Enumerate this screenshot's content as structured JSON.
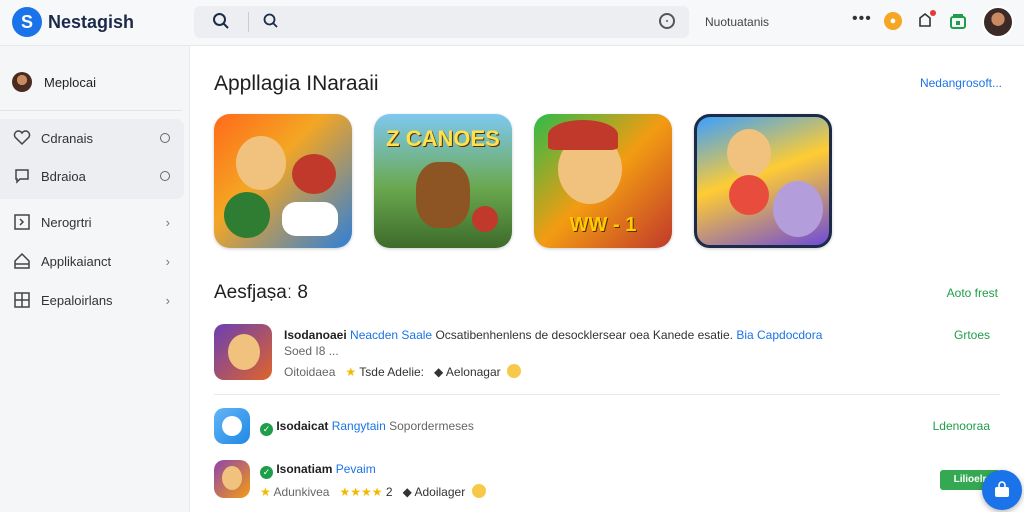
{
  "header": {
    "brand": "Nestagish",
    "search_placeholder": "",
    "link": "Nuotuatanis",
    "coin_icon": "coin-icon",
    "more_icon": "more-dots-icon"
  },
  "sidebar": {
    "profile_name": "Meplocai",
    "items": [
      {
        "label": "Cdranais",
        "icon": "heart-icon",
        "trail": "circle"
      },
      {
        "label": "Bdraioa",
        "icon": "chat-icon",
        "trail": "circle"
      },
      {
        "label": "Nerogrtri",
        "icon": "box-icon",
        "trail": "chevron"
      },
      {
        "label": "Applikaianct",
        "icon": "home-icon",
        "trail": "chevron"
      },
      {
        "label": "Eepaloirlans",
        "icon": "grid-icon",
        "trail": "chevron"
      }
    ]
  },
  "main": {
    "section1_title": "Appllagia INaraaii",
    "section1_link": "Nedangrosoft...",
    "tiles": [
      {
        "name": "game-tile-1",
        "text": ""
      },
      {
        "name": "game-tile-2",
        "text": "Z CANOES"
      },
      {
        "name": "game-tile-3",
        "text": "WW - 1"
      },
      {
        "name": "game-tile-4",
        "text": ""
      }
    ],
    "section2_title": "Aesfjaṣaː 8",
    "section2_link": "Aoto frest",
    "rows": [
      {
        "title": "Isodanoaei",
        "highlight": "Neacden Saale",
        "desc": "Ocsatibenhenlens de desocklersear oea Kanede esatie.",
        "tag": "Bia Capdocdora",
        "sub": "Soed I8 ...",
        "meta1": "Oitoidaea",
        "meta2": "Tsde Adelie:",
        "meta3": "Aelonagar",
        "action": "Grtoes"
      },
      {
        "title": "Isodaicat",
        "highlight": "Rangytain",
        "desc": "Sopordermeses",
        "action": "Ldenooraa"
      },
      {
        "title": "Isonatiam",
        "highlight": "Pevaim",
        "meta1": "Adunkivea",
        "rating": "2",
        "meta3": "Adoilager",
        "action": "Lilioelr"
      }
    ]
  }
}
